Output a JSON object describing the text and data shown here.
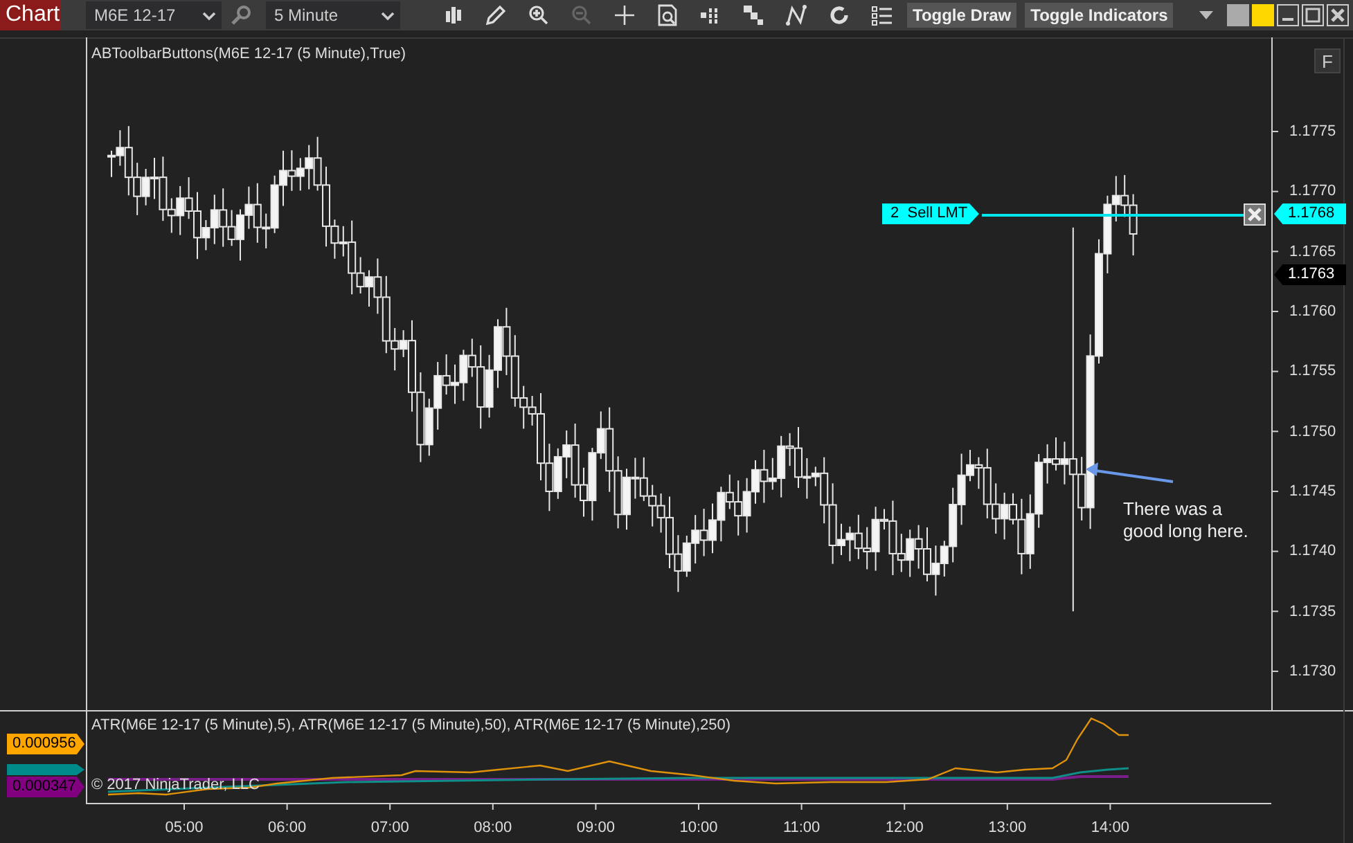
{
  "toolbar": {
    "title": "Chart",
    "instrument": "M6E 12-17",
    "interval": "5 Minute",
    "buttons": [
      "Toggle Draw",
      "Toggle Indicators"
    ]
  },
  "price_panel": {
    "label": "ABToolbarButtons(M6E 12-17 (5 Minute),True)",
    "f_button": "F",
    "price_ticks": [
      "1.1775",
      "1.1770",
      "1.1765",
      "1.1760",
      "1.1755",
      "1.1750",
      "1.1745",
      "1.1740",
      "1.1735",
      "1.1730"
    ],
    "order": {
      "label": "2  Sell LMT",
      "price": "1.1768"
    },
    "last_price": "1.1763",
    "note": "There was a good long here."
  },
  "indicator_panel": {
    "label": "ATR(M6E 12-17 (5 Minute),5), ATR(M6E 12-17 (5 Minute),50), ATR(M6E 12-17 (5 Minute),250)",
    "copyright": "© 2017 NinjaTrader, LLC",
    "values": [
      {
        "text": "0.000956",
        "color": "#ffa500"
      },
      {
        "color": "#008b8b"
      },
      {
        "text": "0.000347",
        "color": "#800080"
      }
    ]
  },
  "time_ticks": [
    "05:00",
    "06:00",
    "07:00",
    "08:00",
    "09:00",
    "10:00",
    "11:00",
    "12:00",
    "13:00",
    "14:00"
  ]
}
